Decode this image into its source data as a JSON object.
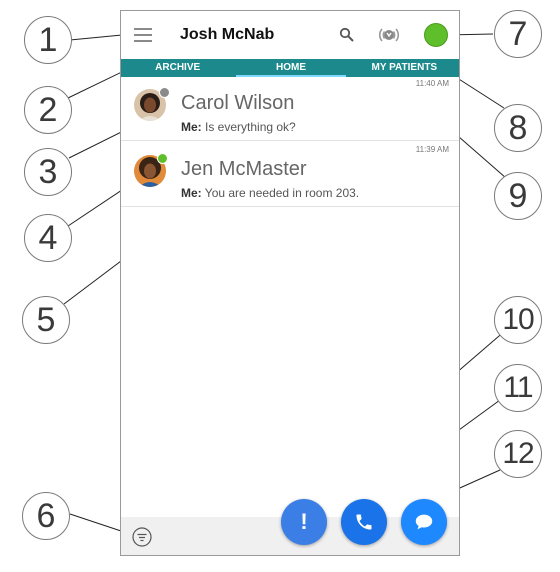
{
  "header": {
    "title": "Josh McNab"
  },
  "tabs": [
    {
      "label": "ARCHIVE"
    },
    {
      "label": "HOME"
    },
    {
      "label": "MY PATIENTS"
    }
  ],
  "conversations": [
    {
      "name": "Carol Wilson",
      "sender": "Me:",
      "message": "Is everything ok?",
      "time": "11:40 AM",
      "presence": "offline"
    },
    {
      "name": "Jen McMaster",
      "sender": "Me:",
      "message": "You are needed in room 203.",
      "time": "11:39 AM",
      "presence": "online"
    }
  ],
  "fabs": {
    "alert_label": "!"
  },
  "callouts": [
    "1",
    "2",
    "3",
    "4",
    "5",
    "6",
    "7",
    "8",
    "9",
    "10",
    "11",
    "12"
  ],
  "colors": {
    "tab_bar": "#1c8a8c",
    "status_online": "#5fbf2a",
    "fab_blue": "#1a73e8"
  },
  "icons": [
    "menu-icon",
    "search-icon",
    "signal-icon",
    "filter-icon",
    "phone-icon",
    "chat-bubble-icon"
  ]
}
